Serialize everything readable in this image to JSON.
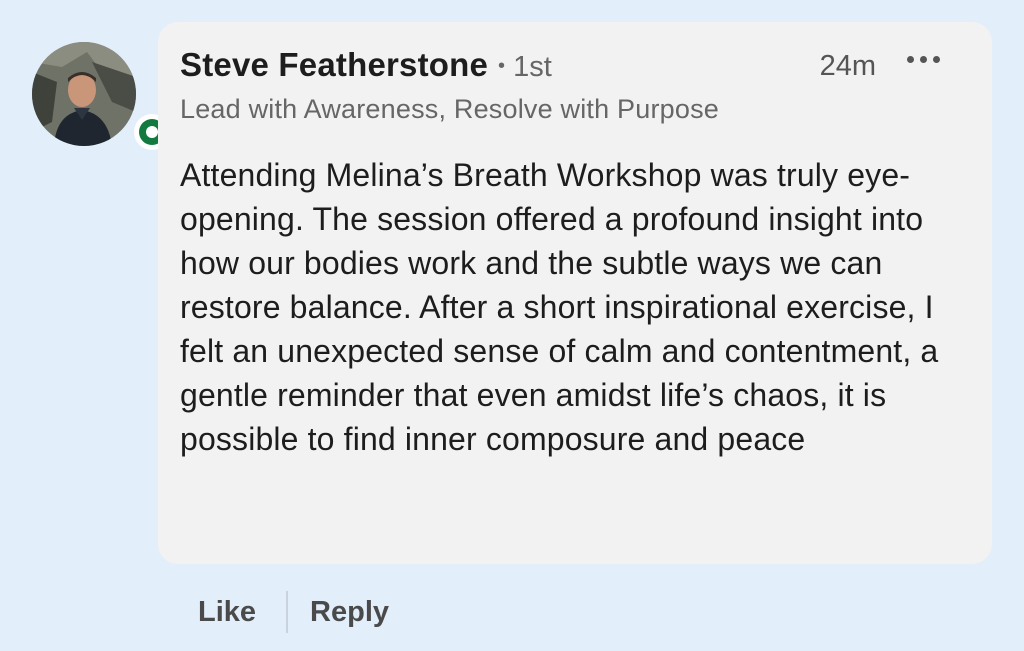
{
  "comment": {
    "author": {
      "name": "Steve Featherstone",
      "separator": "•",
      "degree": "1st",
      "headline": "Lead with Awareness, Resolve with Purpose",
      "avatar": "profile-photo",
      "status": "online"
    },
    "timestamp": "24m",
    "more_icon": "ellipsis-icon",
    "text": "Attending Melina’s Breath Workshop was truly eye-opening. The session offered a profound insight into how our bodies work and the subtle ways we can restore balance. After a short inspirational exercise, I felt an unexpected sense of calm and contentment, a gentle reminder that even amidst life’s chaos, it is possible to find inner composure and peace"
  },
  "actions": {
    "like_label": "Like",
    "reply_label": "Reply"
  },
  "colors": {
    "page_background": "#e3eefb",
    "bubble_background": "#f2f2f2",
    "presence_green": "#127a3e",
    "primary_text": "#1d1d1d",
    "secondary_text": "#666666"
  }
}
